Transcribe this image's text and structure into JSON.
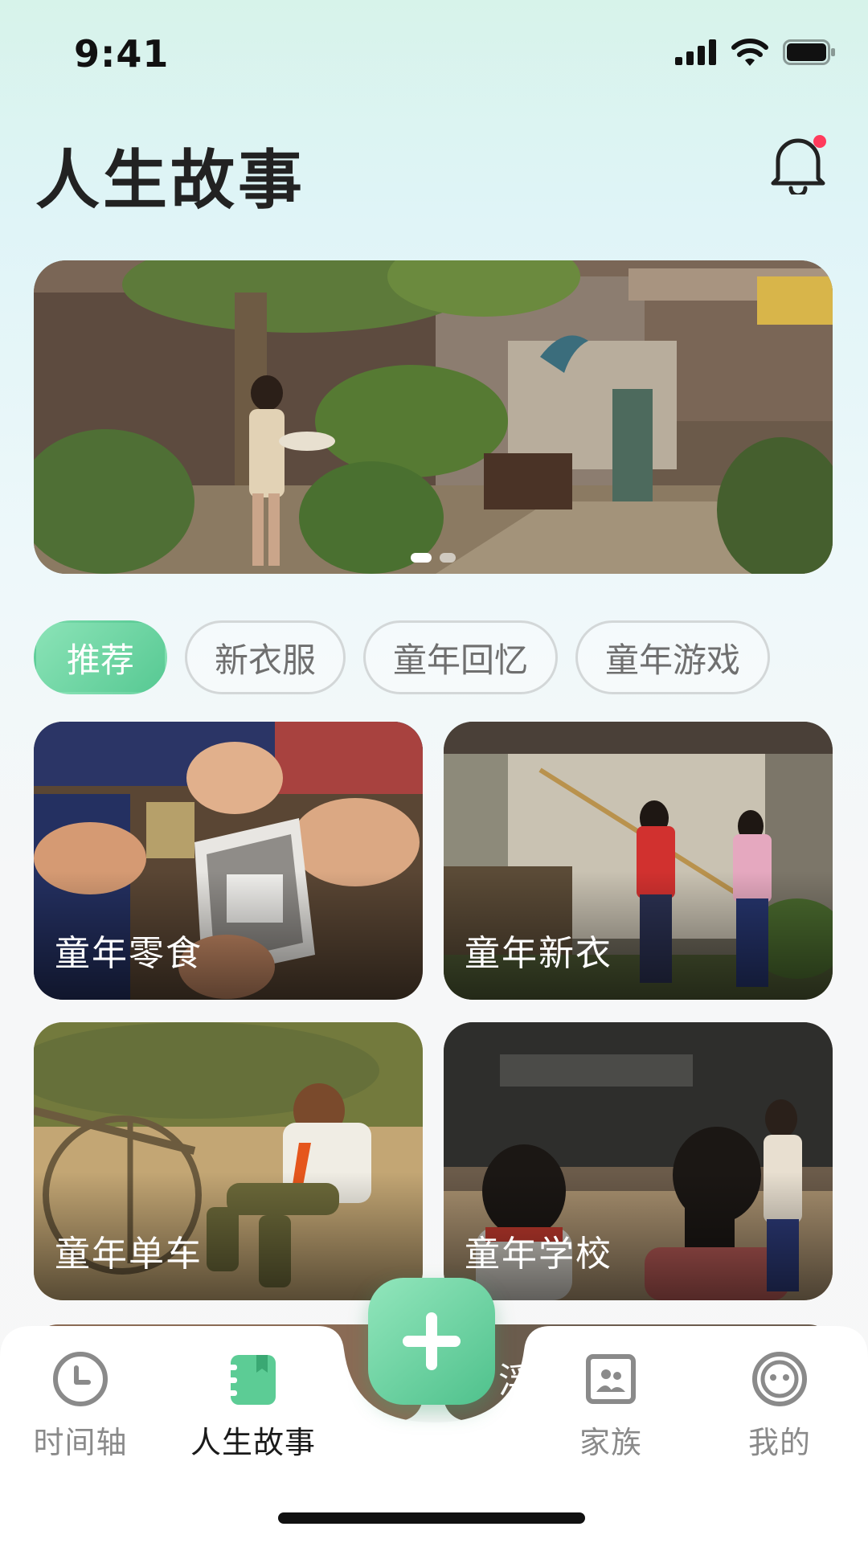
{
  "status_bar": {
    "time": "9:41"
  },
  "header": {
    "title": "人生故事",
    "has_notification": true
  },
  "banner": {
    "pages": 2,
    "active_page": 1
  },
  "chips": [
    {
      "label": "推荐",
      "active": true
    },
    {
      "label": "新衣服",
      "active": false
    },
    {
      "label": "童年回忆",
      "active": false
    },
    {
      "label": "童年游戏",
      "active": false
    }
  ],
  "cards": [
    {
      "label": "童年零食"
    },
    {
      "label": "童年新衣"
    },
    {
      "label": "童年单车"
    },
    {
      "label": "童年学校"
    }
  ],
  "peek_text": "浮",
  "tabbar": {
    "items": [
      {
        "label": "时间轴",
        "icon": "clock-icon",
        "active": false
      },
      {
        "label": "人生故事",
        "icon": "book-icon",
        "active": true
      },
      {
        "label": "家族",
        "icon": "family-photo-icon",
        "active": false
      },
      {
        "label": "我的",
        "icon": "face-icon",
        "active": false
      }
    ],
    "add_icon": "plus-icon"
  },
  "colors": {
    "accent": "#5ccc95",
    "notification": "#ff3b5c",
    "text_primary": "#222222",
    "text_muted": "#8a8a8a"
  }
}
